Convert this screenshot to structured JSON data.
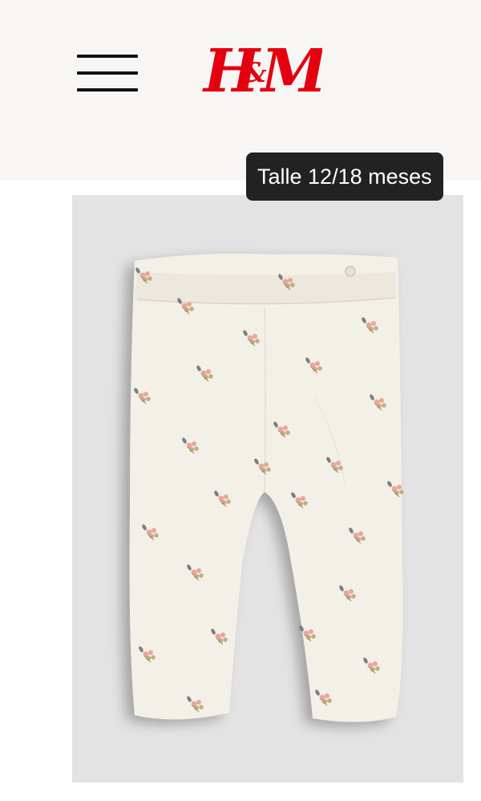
{
  "header": {
    "menu_icon": "hamburger-menu-icon",
    "logo": {
      "left_text": "H",
      "amp": "&",
      "right_text": "M",
      "color": "#e50010"
    }
  },
  "product": {
    "size_badge": "Talle 12/18 meses",
    "image_icon": "baby-leggings-photo",
    "background_color": "#e3e3e3",
    "garment_color": "#f3f0e7"
  }
}
